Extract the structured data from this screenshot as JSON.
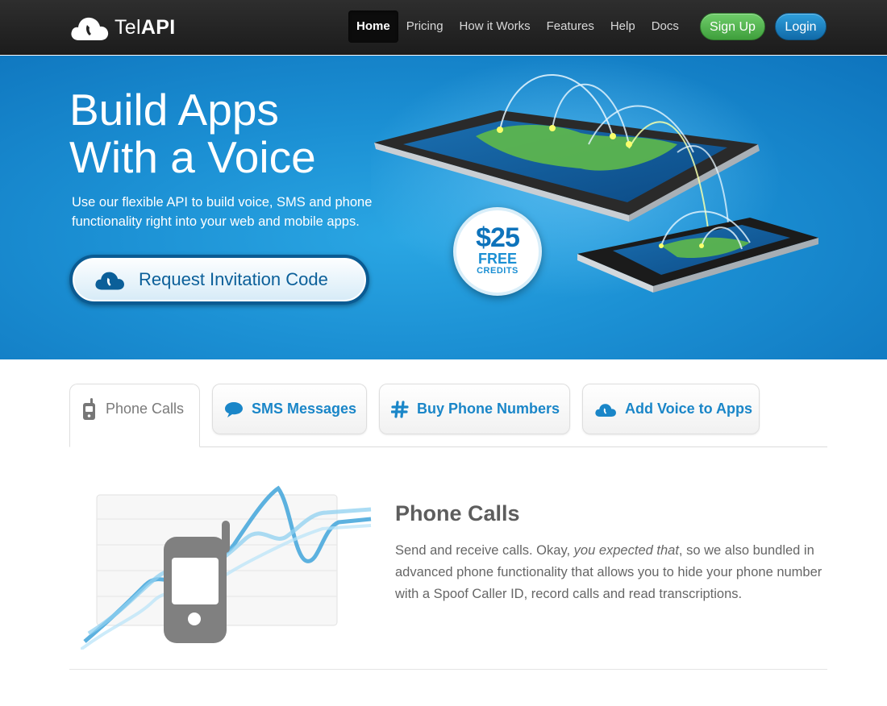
{
  "brand": {
    "name_light": "Tel",
    "name_bold": "API",
    "logo_icon": "cloud-phone-icon"
  },
  "nav": {
    "items": [
      {
        "label": "Home",
        "active": true
      },
      {
        "label": "Pricing"
      },
      {
        "label": "How it Works"
      },
      {
        "label": "Features"
      },
      {
        "label": "Help"
      },
      {
        "label": "Docs"
      }
    ],
    "signup": "Sign Up",
    "login": "Login"
  },
  "hero": {
    "title_line1": "Build Apps",
    "title_line2": "With a Voice",
    "subtitle": "Use our flexible API to build voice, SMS and phone functionality right into your web and mobile apps.",
    "cta": "Request Invitation Code",
    "badge": {
      "amount": "$25",
      "free": "FREE",
      "credits": "CREDITS"
    }
  },
  "tabs": [
    {
      "label": "Phone Calls",
      "icon": "mobile-phone-icon",
      "active": true
    },
    {
      "label": "SMS Messages",
      "icon": "speech-bubble-icon"
    },
    {
      "label": "Buy Phone Numbers",
      "icon": "hash-icon"
    },
    {
      "label": "Add Voice to Apps",
      "icon": "cloud-phone-icon"
    }
  ],
  "feature": {
    "title": "Phone Calls",
    "text_before": "Send and receive calls. Okay, ",
    "text_italic": "you expected that",
    "text_after": ", so we also bundled in advanced phone functionality that allows you to hide your phone number with a Spoof Caller ID, record calls and read transcriptions."
  },
  "colors": {
    "nav_bg": "#222222",
    "hero_blue": "#1b8fd3",
    "accent_blue": "#1a86c8",
    "signup_green": "#4cae48",
    "login_blue": "#1a7fbf"
  }
}
